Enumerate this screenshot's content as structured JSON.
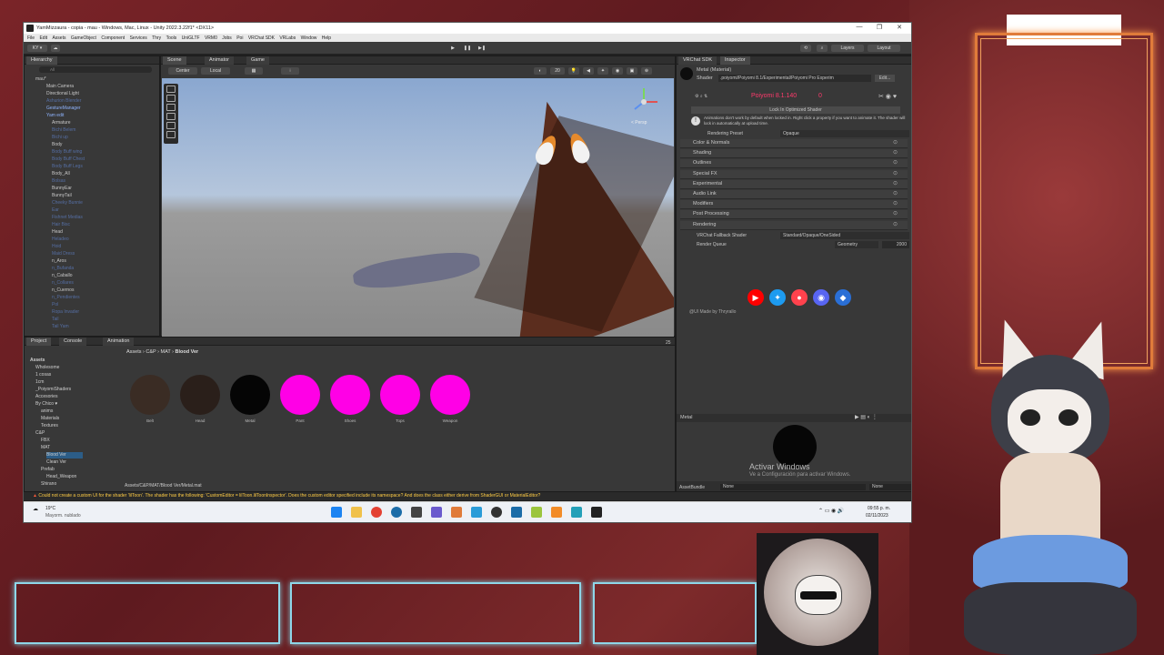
{
  "window": {
    "title": "YamMizzaura - copia - mau - Windows, Mac, Linux - Unity 2022.3.22f1* <DX11>",
    "controls": [
      "—",
      "❐",
      "✕"
    ]
  },
  "menu": [
    "File",
    "Edit",
    "Assets",
    "GameObject",
    "Component",
    "Services",
    "Thry",
    "Tools",
    "UniGLTF",
    "VRM0",
    "Jobs",
    "Poi",
    "VRChat SDK",
    "VRLabs",
    "Window",
    "Help"
  ],
  "toolbar": {
    "account": "KY ▾",
    "layers": "Layers",
    "layout": "Layout"
  },
  "hierarchy": {
    "tab": "Hierarchy",
    "search_placeholder": "All",
    "rows": [
      {
        "label": "mau*",
        "style": "normal",
        "indent": 0
      },
      {
        "label": "Main Camera",
        "style": "normal",
        "indent": 2
      },
      {
        "label": "Directional Light",
        "style": "normal",
        "indent": 2
      },
      {
        "label": "Ashurion Blender",
        "style": "dim",
        "indent": 2
      },
      {
        "label": "GestureManager",
        "style": "blue",
        "indent": 2
      },
      {
        "label": "Yam edit",
        "style": "blue",
        "indent": 2
      },
      {
        "label": "Armature",
        "style": "normal",
        "indent": 3
      },
      {
        "label": "Bichi Belem",
        "style": "dim",
        "indent": 3
      },
      {
        "label": "Bichi up",
        "style": "dim",
        "indent": 3
      },
      {
        "label": "Body",
        "style": "normal",
        "indent": 3
      },
      {
        "label": "Body Buff wing",
        "style": "dim",
        "indent": 3
      },
      {
        "label": "Body Buff Chest",
        "style": "dim",
        "indent": 3
      },
      {
        "label": "Body Buff Legs",
        "style": "dim",
        "indent": 3
      },
      {
        "label": "Body_All",
        "style": "normal",
        "indent": 3
      },
      {
        "label": "Bolsas",
        "style": "dim",
        "indent": 3
      },
      {
        "label": "BunnyEar",
        "style": "normal",
        "indent": 3
      },
      {
        "label": "BunnyTail",
        "style": "normal",
        "indent": 3
      },
      {
        "label": "Cheeky Bunnie",
        "style": "dim",
        "indent": 3
      },
      {
        "label": "Ear",
        "style": "dim",
        "indent": 3
      },
      {
        "label": "Fishnet Medias",
        "style": "dim",
        "indent": 3
      },
      {
        "label": "Hair Bisc",
        "style": "dim",
        "indent": 3
      },
      {
        "label": "Head",
        "style": "normal",
        "indent": 3
      },
      {
        "label": "Heladeo",
        "style": "dim",
        "indent": 3
      },
      {
        "label": "Hoid",
        "style": "dim",
        "indent": 3
      },
      {
        "label": "Maid Dress",
        "style": "dim",
        "indent": 3
      },
      {
        "label": "n_Aros",
        "style": "normal",
        "indent": 3
      },
      {
        "label": "n_Bufanda",
        "style": "dim",
        "indent": 3
      },
      {
        "label": "n_Caballo",
        "style": "normal",
        "indent": 3
      },
      {
        "label": "n_Collares",
        "style": "dim",
        "indent": 3
      },
      {
        "label": "n_Cuernos",
        "style": "normal",
        "indent": 3
      },
      {
        "label": "n_Pendientes",
        "style": "dim",
        "indent": 3
      },
      {
        "label": "Pol",
        "style": "dim",
        "indent": 3
      },
      {
        "label": "Ropa Invader",
        "style": "dim",
        "indent": 3
      },
      {
        "label": "Tail",
        "style": "dim",
        "indent": 3
      },
      {
        "label": "Tail Yam",
        "style": "dim",
        "indent": 3
      }
    ]
  },
  "scene": {
    "tabs": [
      "Scene",
      "Animator",
      "Game"
    ],
    "pivot": "Center",
    "space": "Local",
    "counter": "20",
    "persp_label": "< Persp"
  },
  "project": {
    "tabs": [
      "Project",
      "Console",
      "Animation"
    ],
    "breadcrumb": [
      "Assets",
      "C&P",
      "MAT",
      "Blood Ver"
    ],
    "count": "25",
    "tree": [
      {
        "label": "Assets",
        "indent": 0,
        "bold": true
      },
      {
        "label": "Wholesome",
        "indent": 1
      },
      {
        "label": "1 cosas",
        "indent": 1
      },
      {
        "label": "1cm",
        "indent": 1
      },
      {
        "label": "_PoiyomiShaders",
        "indent": 1
      },
      {
        "label": "Accesories",
        "indent": 1
      },
      {
        "label": "By Chico ♥",
        "indent": 1
      },
      {
        "label": "anims",
        "indent": 2
      },
      {
        "label": "Materials",
        "indent": 2
      },
      {
        "label": "Textures",
        "indent": 2
      },
      {
        "label": "C&P",
        "indent": 1
      },
      {
        "label": "FBX",
        "indent": 2
      },
      {
        "label": "MAT",
        "indent": 2
      },
      {
        "label": "Blood Ver",
        "indent": 3,
        "selected": true
      },
      {
        "label": "Clean Ver",
        "indent": 3
      },
      {
        "label": "Prefab",
        "indent": 2
      },
      {
        "label": "Head_Weapon",
        "indent": 3
      },
      {
        "label": "Shirano",
        "indent": 2
      }
    ],
    "assets": [
      {
        "label": "Belt",
        "color": "#3a2c24"
      },
      {
        "label": "Head",
        "color": "#2a1f1a"
      },
      {
        "label": "Metal",
        "color": "#050505"
      },
      {
        "label": "Pant",
        "color": "#ff00e6"
      },
      {
        "label": "Shoes",
        "color": "#ff00e6"
      },
      {
        "label": "Tops",
        "color": "#ff00e6"
      },
      {
        "label": "Weapon",
        "color": "#ff00e6"
      }
    ],
    "path": "Assets/C&P/MAT/Blood Ver/Metal.mat"
  },
  "inspector": {
    "tabs": [
      "VRChat SDK",
      "Inspector"
    ],
    "material": "Metal (Material)",
    "shader_label": "Shader",
    "shader": ".poiyomi/Poiyomi 8.1/Experimental/Poiyomi Pro Experim",
    "edit": "Edit...",
    "version": "Poiyomi 8.1.140",
    "version_num": "0",
    "lock": "Lock In Optimized Shader",
    "warning": "Animations don't work by default when locked in. Right click a property if you want to animate it. The shader will lock in automatically at upload time.",
    "rendering_preset_label": "Rendering Preset",
    "rendering_preset": "Opaque",
    "sections": [
      "Color & Normals",
      "Shading",
      "Outlines",
      "Special FX",
      "Experimental",
      "Audio Link",
      "Modifiers",
      "Post Processing",
      "Rendering"
    ],
    "fallback_label": "VRChat Fallback Shader",
    "fallback": "Standard/Opaque/OneSided",
    "queue_label": "Render Queue",
    "queue_mode": "Geometry",
    "queue_value": "2000",
    "made_by": "@UI Made by Thryrallo",
    "preview_label": "Metal",
    "assetbundle_label": "AssetBundle",
    "assetbundle": "None",
    "assetbundle_variant": "None",
    "activate_title": "Activar Windows",
    "activate_sub": "Ve a Configuración para activar Windows."
  },
  "console_error": "Could not create a custom UI for the shader 'lilToon'. The shader has the following: 'CustomEditor = lilToon.lilToonInspector'. Does the custom editor specified include its namespace? And does the class either derive from ShaderGUI or MaterialEditor?",
  "taskbar": {
    "weather_temp": "19°C",
    "weather_text": "Mayorm. nublado",
    "time": "09:55 p. m.",
    "date": "02/11/2023"
  }
}
